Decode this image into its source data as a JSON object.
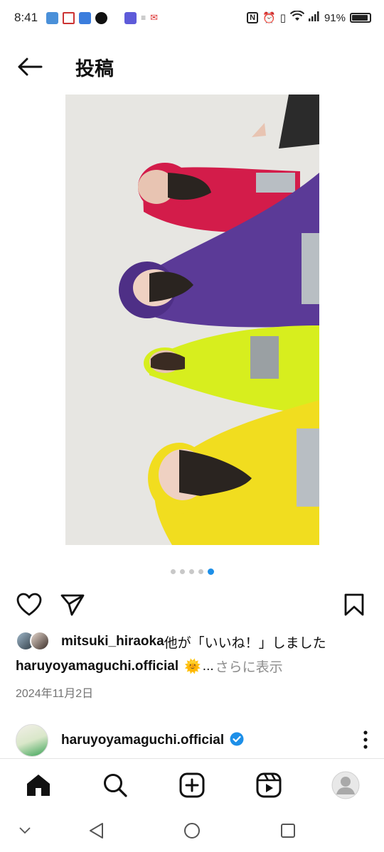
{
  "status_bar": {
    "time": "8:41",
    "battery_percent": "91%",
    "notification_icons": [
      "gallery-icon",
      "news-icon",
      "video-icon",
      "tiktok-icon",
      "yahoo-icon",
      "list-icon",
      "mail-icon"
    ],
    "system_icons": [
      "nfc-icon",
      "alarm-icon",
      "vibrate-icon",
      "wifi-icon",
      "signal-icon",
      "battery-icon"
    ]
  },
  "header": {
    "title": "投稿",
    "back_icon": "arrow-left-icon"
  },
  "post": {
    "carousel": {
      "total": 5,
      "active_index": 4
    },
    "likes_text_user": "mitsuki_hiraoka",
    "likes_text_rest": "他が「いいね！」しました",
    "caption_user": "haruyoyamaguchi.official",
    "caption_emoji": "🌞",
    "caption_ellipsis": "...",
    "more_label": "さらに表示",
    "date": "2024年11月2日"
  },
  "next_post": {
    "username": "haruyoyamaguchi.official",
    "verified": true
  },
  "tabbar": {
    "items": [
      "home-icon",
      "search-icon",
      "create-icon",
      "reels-icon",
      "profile-icon"
    ],
    "active": "home-icon"
  },
  "colors": {
    "accent": "#1d8fe8",
    "verified": "#1d8fe8",
    "text": "#111111",
    "muted": "#8e8e8e"
  }
}
